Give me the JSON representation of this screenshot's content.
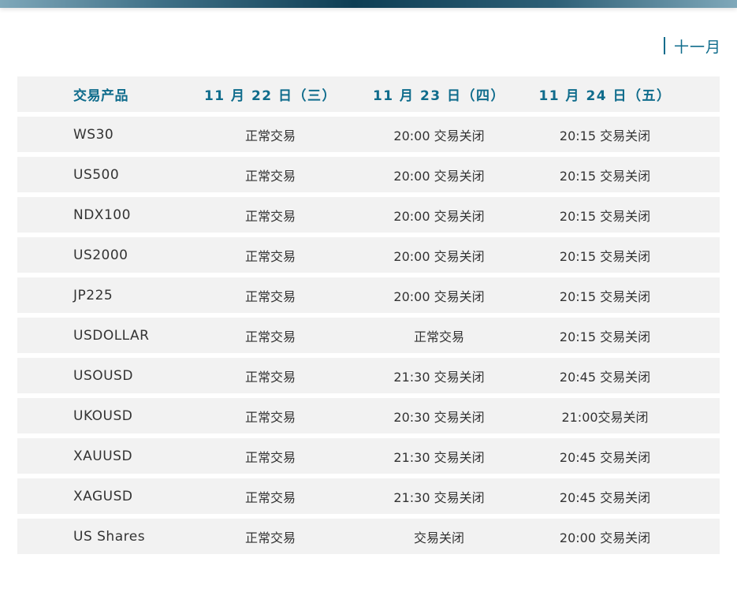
{
  "month": "十一月",
  "table": {
    "headers": [
      "交易产品",
      "11 月 22 日（三）",
      "11 月 23 日（四）",
      "11 月 24 日（五）"
    ],
    "rows": [
      [
        "WS30",
        "正常交易",
        "20:00 交易关闭",
        "20:15 交易关闭"
      ],
      [
        "US500",
        "正常交易",
        "20:00 交易关闭",
        "20:15 交易关闭"
      ],
      [
        "NDX100",
        "正常交易",
        "20:00 交易关闭",
        "20:15 交易关闭"
      ],
      [
        "US2000",
        "正常交易",
        "20:00 交易关闭",
        "20:15 交易关闭"
      ],
      [
        "JP225",
        "正常交易",
        "20:00 交易关闭",
        "20:15 交易关闭"
      ],
      [
        "USDOLLAR",
        "正常交易",
        "正常交易",
        "20:15 交易关闭"
      ],
      [
        "USOUSD",
        "正常交易",
        "21:30 交易关闭",
        "20:45 交易关闭"
      ],
      [
        "UKOUSD",
        "正常交易",
        "20:30 交易关闭",
        "21:00交易关闭"
      ],
      [
        "XAUUSD",
        "正常交易",
        "21:30 交易关闭",
        "20:45 交易关闭"
      ],
      [
        "XAGUSD",
        "正常交易",
        "21:30 交易关闭",
        "20:45 交易关闭"
      ],
      [
        "US Shares",
        "正常交易",
        "交易关闭",
        "20:00 交易关闭"
      ]
    ]
  }
}
